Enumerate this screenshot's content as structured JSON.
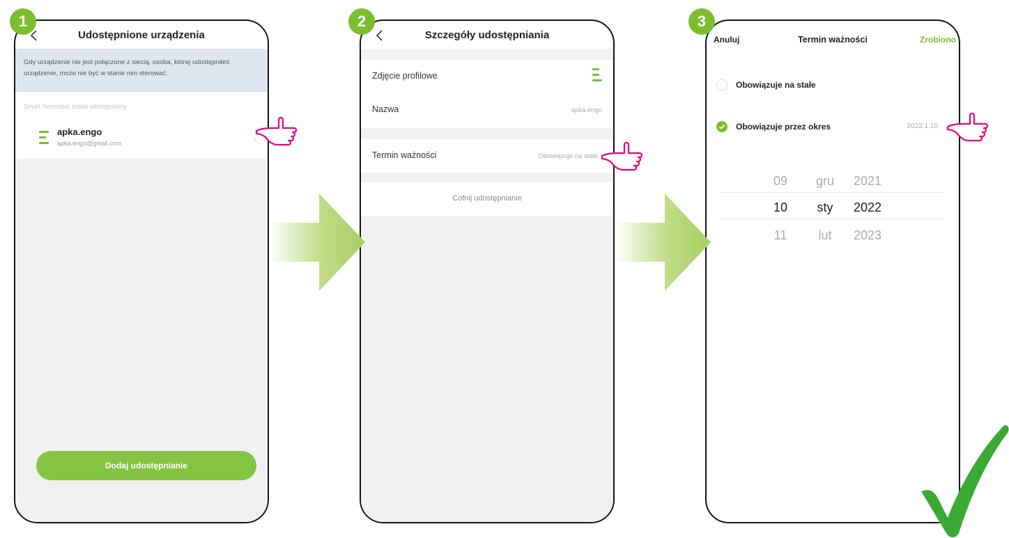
{
  "steps": [
    "1",
    "2",
    "3"
  ],
  "screen1": {
    "title": "Udostępnione urządzenia",
    "info": "Gdy urządzenie nie jest połączone z siecią, osoba, której udostępniłeś urządzenie, może nie być w stanie nim sterować.",
    "section_label": "Smart Termostat został udostępniony",
    "user": {
      "name": "apka.engo",
      "email": "apka.engo@gmail.com"
    },
    "button": "Dodaj udostępnianie"
  },
  "screen2": {
    "title": "Szczegóły udostępniania",
    "photo_label": "Zdjęcie profilowe",
    "name_label": "Nazwa",
    "name_value": "apka.engo",
    "expiry_label": "Termin ważności",
    "expiry_value": "Obowiązuje na stałe",
    "revoke": "Cofnij udostępnianie"
  },
  "screen3": {
    "cancel": "Anuluj",
    "title": "Termin ważności",
    "done": "Zrobiono",
    "option_permanent": "Obowiązuje na stałe",
    "option_period": "Obowiązuje przez okres",
    "period_date": "2022.1.10",
    "picker": [
      {
        "day": "09",
        "month": "gru",
        "year": "2021"
      },
      {
        "day": "10",
        "month": "sty",
        "year": "2022"
      },
      {
        "day": "11",
        "month": "lut",
        "year": "2023"
      }
    ]
  },
  "colors": {
    "accent": "#7cbd2d",
    "hand": "#e6007e",
    "arrow": "#b7d878",
    "check": "#3aaa35"
  }
}
